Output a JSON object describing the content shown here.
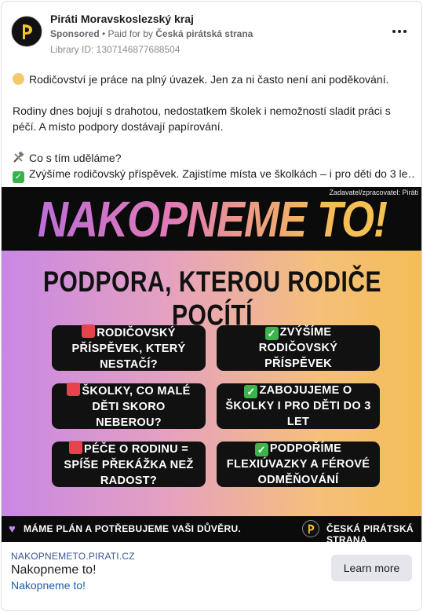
{
  "header": {
    "page_name": "Piráti Moravskoslezský kraj",
    "sponsored": "Sponsored",
    "paid_prefix": " • Paid for by ",
    "payer": "Česká pirátská strana",
    "library_id": "Library ID: 1307146877688504"
  },
  "body": {
    "line1": "Rodičovství je práce na plný úvazek. Jen za ni často není ani poděkování.",
    "line2": "Rodiny dnes bojují s drahotou, nedostatkem školek i nemožností sladit práci s",
    "line3": "péčí. A místo podpory dostávají papírování.",
    "line4": "Co s tím uděláme?",
    "line5": "Zvýšíme rodičovský příspěvek. Zajistíme místa ve školkách – i pro děti do 3 le…"
  },
  "creative": {
    "credit": "Zadavatel/zpracovatel: Piráti",
    "headline": "NAKOPNEME TO!",
    "subheadline": "PODPORA, KTEROU RODIČE POCÍTÍ",
    "problems": [
      "RODIČOVSKÝ PŘÍSPĚVEK, KTERÝ NESTAČÍ?",
      "ŠKOLKY, CO MALÉ DĚTI SKORO NEBEROU?",
      "PÉČE O RODINU = SPÍŠE PŘEKÁŽKA NEŽ RADOST?"
    ],
    "solutions": [
      "ZVÝŠÍME RODIČOVSKÝ PŘÍSPĚVEK",
      "ZABOJUJEME O ŠKOLKY I PRO DĚTI DO 3 LET",
      "PODPOŘÍME FLEXIÚVAZKY A FÉROVÉ ODMĚŇOVÁNÍ"
    ],
    "trust_line": "MÁME PLÁN A POTŘEBUJEME VAŠI DŮVĚRU.",
    "party": "ČESKÁ PIRÁTSKÁ STRANA"
  },
  "link": {
    "domain": "NAKOPNEMETO.PIRATI.CZ",
    "title": "Nakopneme to!",
    "description": "Nakopneme to!",
    "button": "Learn more"
  },
  "colors": {
    "link_blue": "#385898",
    "problem_mark": "#e8424c",
    "solution_mark": "#3cb44a",
    "heart": "#b88cf0"
  },
  "icons": {
    "baby": "baby-emoji-icon",
    "tools": "hammer-wrench-icon",
    "check": "check-mark-icon",
    "more": "more-options-icon",
    "heart": "purple-heart-icon",
    "logo": "pirate-flag-logo-icon"
  }
}
